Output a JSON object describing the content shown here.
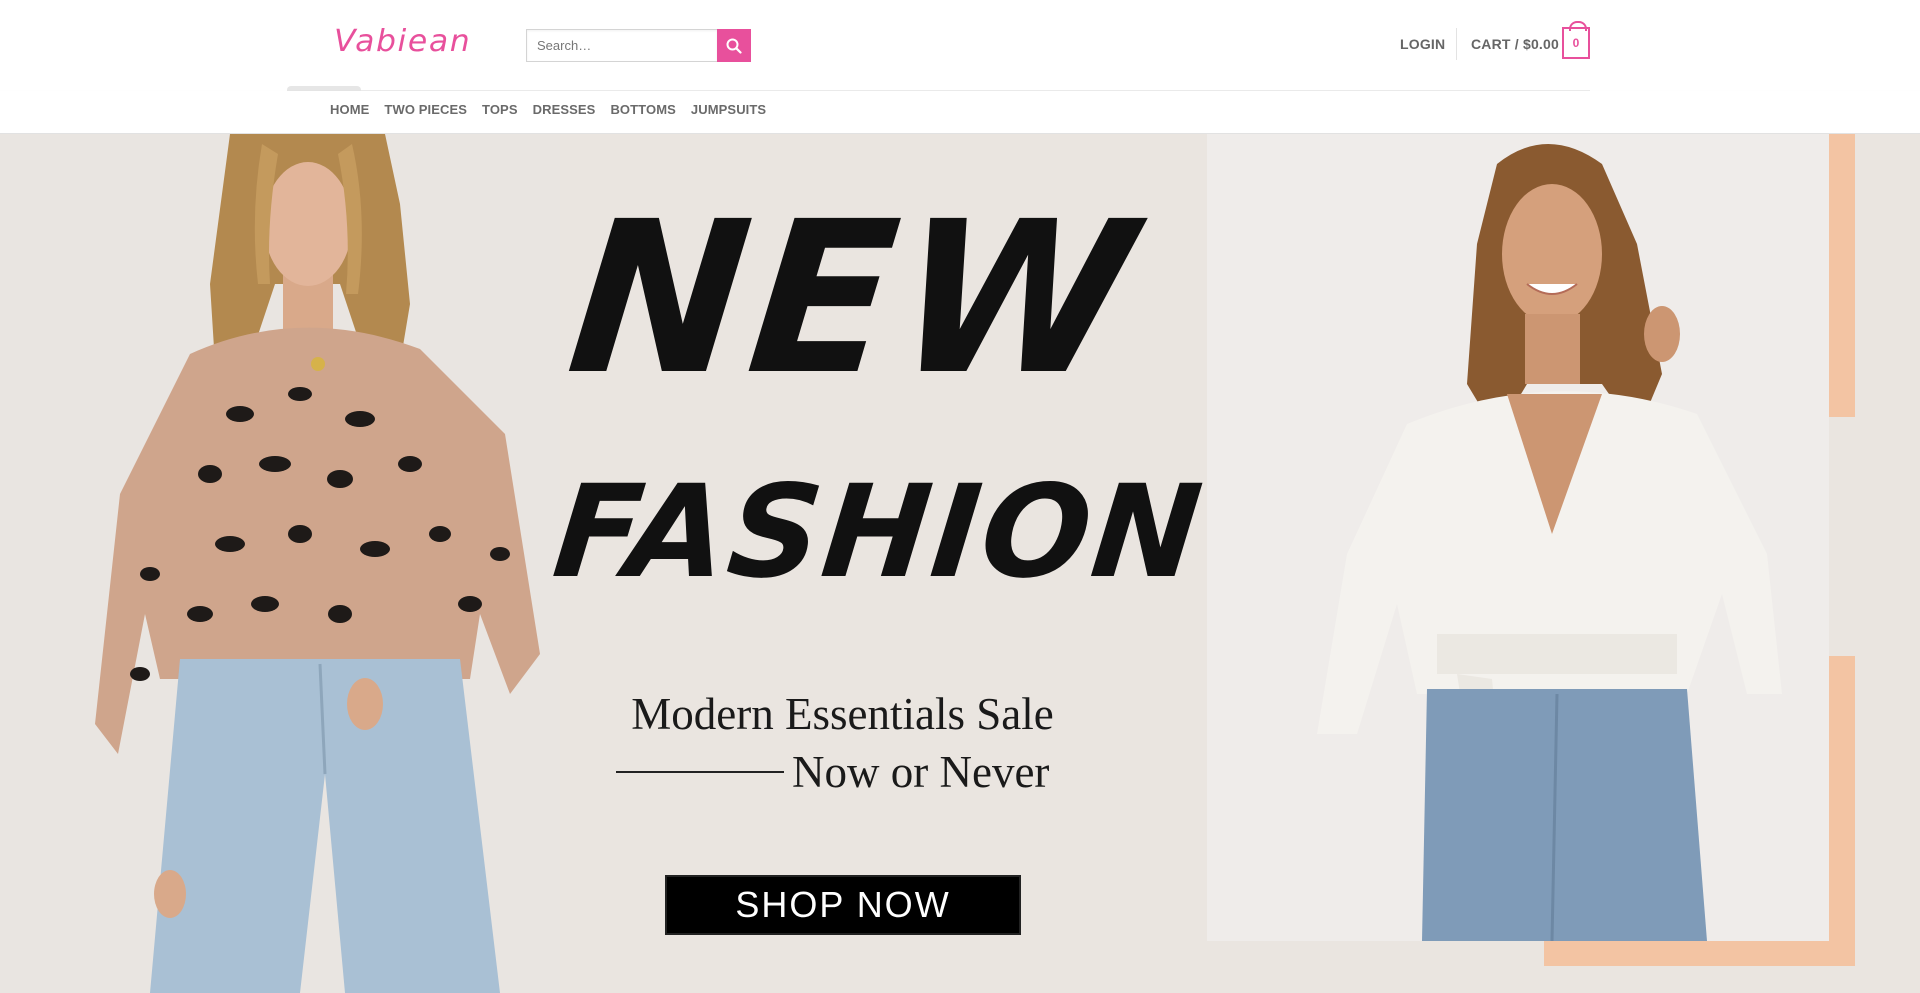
{
  "brand": {
    "logo_text": "Vabiean",
    "accent_color": "#e8509c"
  },
  "search": {
    "placeholder": "Search…",
    "icon": "search-icon"
  },
  "account": {
    "login_label": "LOGIN"
  },
  "cart": {
    "label": "CART / $0.00",
    "count": "0",
    "icon": "cart-bag-icon"
  },
  "nav": {
    "items": [
      {
        "label": "HOME"
      },
      {
        "label": "TWO PIECES"
      },
      {
        "label": "TOPS"
      },
      {
        "label": "DRESSES"
      },
      {
        "label": "BOTTOMS"
      },
      {
        "label": "JUMPSUITS"
      }
    ]
  },
  "hero": {
    "headline_1": "NEW",
    "headline_2": "FASHION",
    "tagline_1": "Modern Essentials Sale",
    "tagline_2": "Now or Never",
    "cta_label": "SHOP NOW",
    "background_color": "#eae5e0",
    "frame_color": "#f3c4a3",
    "left_image": "model-leopard-sweater-light-jeans",
    "right_image": "model-white-wrap-sweater-jeans"
  }
}
